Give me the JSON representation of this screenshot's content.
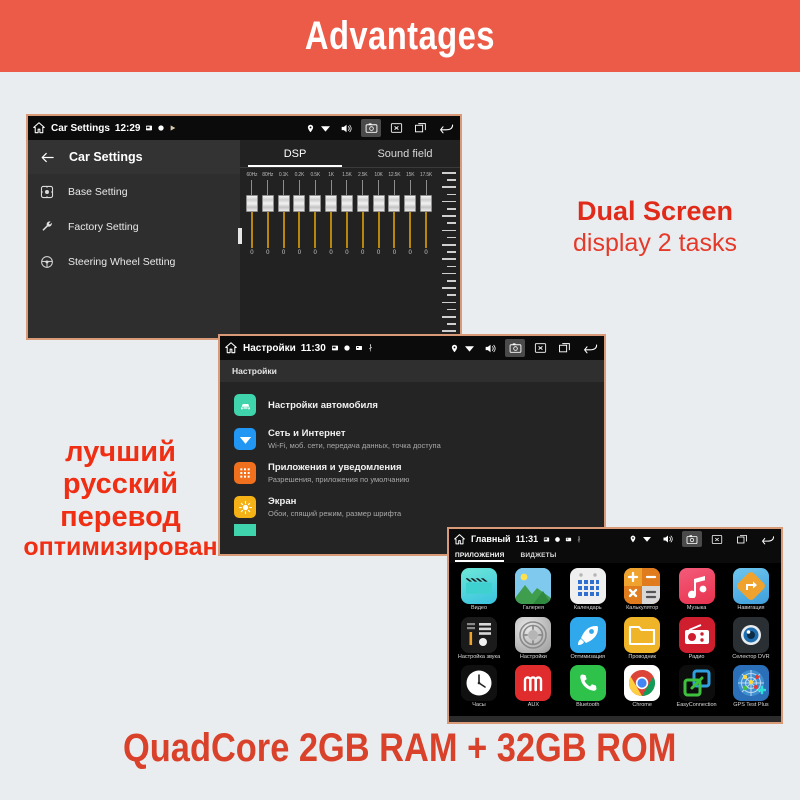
{
  "header": {
    "title": "Advantages",
    "bg": "#ec5a48",
    "fg": "#ffffff"
  },
  "marketing": {
    "dual_screen_line1": "Dual Screen",
    "dual_screen_line2": "display 2 tasks",
    "russian_line1": "лучший",
    "russian_line2": "русский",
    "russian_line3": "перевод",
    "russian_line4": "оптимизирован",
    "footer": "QuadCore 2GB RAM + 32GB ROM",
    "accent_red": "#e02b1b",
    "footer_red": "#d9412a"
  },
  "screen1": {
    "statusbar": {
      "home_icon": "home-icon",
      "title": "Car Settings",
      "time": "12:29",
      "mini_icons": [
        "sd-card-icon",
        "record-dot-icon",
        "play-triangle-icon"
      ],
      "right_icons": [
        "gps-pin-icon",
        "wifi-icon",
        "speaker-icon",
        "camera-icon",
        "close-box-icon",
        "recent-apps-icon",
        "back-arrow-icon"
      ],
      "active_icon": "camera-icon"
    },
    "panel": {
      "back_icon": "back-arrow-icon",
      "title": "Car Settings",
      "items": [
        {
          "icon": "brightness-icon",
          "label": "Base Setting"
        },
        {
          "icon": "wrench-icon",
          "label": "Factory Setting"
        },
        {
          "icon": "steering-wheel-icon",
          "label": "Steering Wheel Setting"
        }
      ]
    },
    "dsp": {
      "tabs": [
        {
          "label": "DSP",
          "selected": true
        },
        {
          "label": "Sound field",
          "selected": false
        }
      ],
      "eq_bands": [
        {
          "freq": "60Hz",
          "value": "0"
        },
        {
          "freq": "80Hz",
          "value": "0"
        },
        {
          "freq": "0.1K",
          "value": "0"
        },
        {
          "freq": "0.2K",
          "value": "0"
        },
        {
          "freq": "0.5K",
          "value": "0"
        },
        {
          "freq": "1K",
          "value": "0"
        },
        {
          "freq": "1.5K",
          "value": "0"
        },
        {
          "freq": "2.5K",
          "value": "0"
        },
        {
          "freq": "10K",
          "value": "0"
        },
        {
          "freq": "12.5K",
          "value": "0"
        },
        {
          "freq": "15K",
          "value": "0"
        },
        {
          "freq": "17.5K",
          "value": "0"
        }
      ]
    }
  },
  "screen2": {
    "statusbar": {
      "home_icon": "home-icon",
      "title": "Настройки",
      "time": "11:30",
      "mini_icons": [
        "sd-card-icon",
        "record-dot-icon",
        "sim-card-icon",
        "usb-icon"
      ],
      "right_icons": [
        "gps-pin-icon",
        "wifi-icon",
        "speaker-icon",
        "camera-icon",
        "close-box-icon",
        "recent-apps-icon",
        "back-arrow-icon"
      ],
      "active_icon": "camera-icon"
    },
    "subheader": "Настройки",
    "items": [
      {
        "icon": "car-icon",
        "color": "#3fd4ac",
        "title": "Настройки автомобиля",
        "subtitle": ""
      },
      {
        "icon": "wifi-icon",
        "color": "#2196f3",
        "title": "Сеть и Интернет",
        "subtitle": "Wi-Fi, моб. сети, передача данных, точка доступа"
      },
      {
        "icon": "apps-grid-icon",
        "color": "#f0701e",
        "title": "Приложения и уведомления",
        "subtitle": "Разрешения, приложения по умолчанию"
      },
      {
        "icon": "brightness-icon",
        "color": "#f5b216",
        "title": "Экран",
        "subtitle": "Обои, спящий режим, размер шрифта"
      },
      {
        "icon": "sound-icon",
        "color": "#3fd4ac",
        "title": "",
        "subtitle": ""
      }
    ]
  },
  "screen3": {
    "statusbar": {
      "home_icon": "home-icon",
      "title": "Главный",
      "time": "11:31",
      "mini_icons": [
        "sd-card-icon",
        "record-dot-icon",
        "sim-card-icon",
        "usb-icon"
      ],
      "right_icons": [
        "gps-pin-icon",
        "wifi-icon",
        "speaker-icon",
        "camera-icon",
        "close-box-icon",
        "recent-apps-icon",
        "back-arrow-icon"
      ],
      "active_icon": "camera-icon"
    },
    "tabs": [
      {
        "label": "ПРИЛОЖЕНИЯ",
        "selected": true
      },
      {
        "label": "ВИДЖЕТЫ",
        "selected": false
      }
    ],
    "apps": [
      [
        {
          "icon": "video-icon",
          "label": "Видео"
        },
        {
          "icon": "gallery-icon",
          "label": "Галерея"
        },
        {
          "icon": "calendar-icon",
          "label": "Календарь"
        },
        {
          "icon": "calculator-icon",
          "label": "Калькулятор"
        },
        {
          "icon": "music-icon",
          "label": "Музыка"
        },
        {
          "icon": "navigation-icon",
          "label": "Навигация"
        }
      ],
      [
        {
          "icon": "sound-mixer-icon",
          "label": "Настройка звука"
        },
        {
          "icon": "settings-gear-icon",
          "label": "Настройки"
        },
        {
          "icon": "rocket-icon",
          "label": "Оптимизация"
        },
        {
          "icon": "folder-icon",
          "label": "Проводник"
        },
        {
          "icon": "radio-icon",
          "label": "Радио"
        },
        {
          "icon": "dvr-eye-icon",
          "label": "Селектор DVR"
        }
      ],
      [
        {
          "icon": "clock-icon",
          "label": "Часы"
        },
        {
          "icon": "aux-cable-icon",
          "label": "AUX"
        },
        {
          "icon": "phone-icon",
          "label": "Bluetooth"
        },
        {
          "icon": "chrome-icon",
          "label": "Chrome"
        },
        {
          "icon": "easyconnect-icon",
          "label": "EasyConnection"
        },
        {
          "icon": "gps-radar-icon",
          "label": "GPS Test Plus"
        }
      ]
    ]
  }
}
